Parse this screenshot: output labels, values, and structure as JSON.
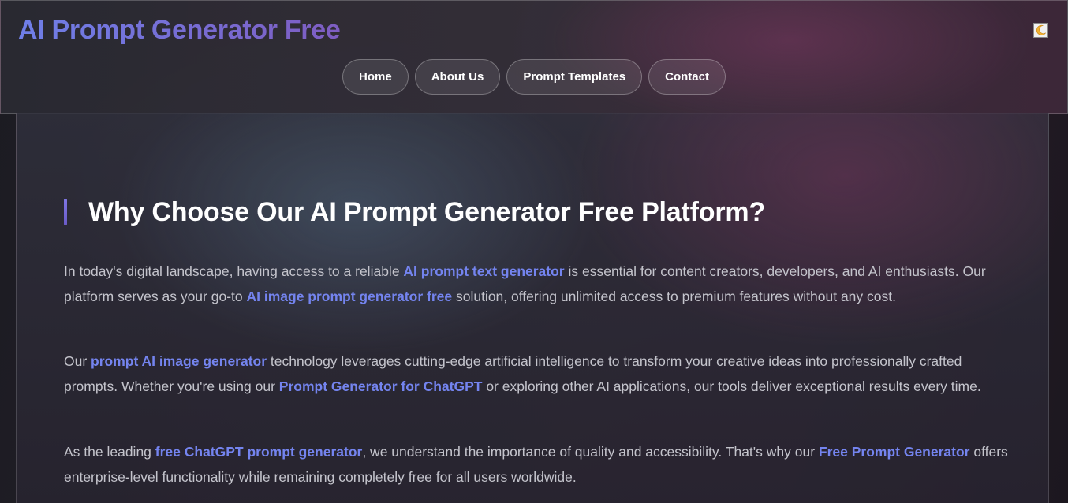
{
  "header": {
    "brand": "AI Prompt Generator Free",
    "theme_toggle_icon": "moon-icon",
    "nav": [
      {
        "label": "Home"
      },
      {
        "label": "About Us"
      },
      {
        "label": "Prompt Templates"
      },
      {
        "label": "Contact"
      }
    ]
  },
  "content": {
    "title": "Why Choose Our AI Prompt Generator Free Platform?",
    "p1": {
      "t1": "In today's digital landscape, having access to a reliable ",
      "k1": "AI prompt text generator",
      "t2": " is essential for content creators, developers, and AI enthusiasts. Our platform serves as your go-to ",
      "k2": "AI image prompt generator free",
      "t3": " solution, offering unlimited access to premium features without any cost."
    },
    "p2": {
      "t1": "Our ",
      "k1": "prompt AI image generator",
      "t2": " technology leverages cutting-edge artificial intelligence to transform your creative ideas into professionally crafted prompts. Whether you're using our ",
      "k2": "Prompt Generator for ChatGPT",
      "t3": " or exploring other AI applications, our tools deliver exceptional results every time."
    },
    "p3": {
      "t1": "As the leading ",
      "k1": "free ChatGPT prompt generator",
      "t2": ", we understand the importance of quality and accessibility. That's why our ",
      "k2": "Free Prompt Generator",
      "t3": " offers enterprise-level functionality while remaining completely free for all users worldwide."
    }
  },
  "colors": {
    "accent": "#7484ef",
    "brand_gradient_start": "#6f7fe8",
    "brand_gradient_end": "#7e5dc2"
  }
}
